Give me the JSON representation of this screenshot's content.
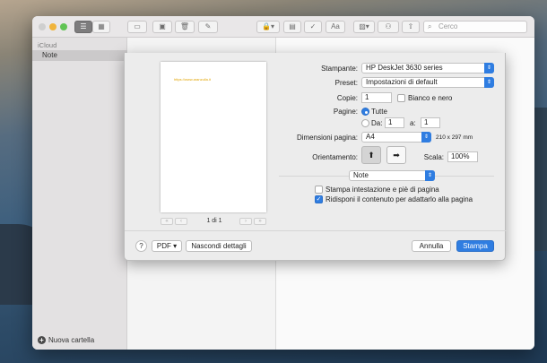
{
  "search": {
    "placeholder": "Cerco",
    "icon": "search-icon"
  },
  "sidebar": {
    "heading": "iCloud",
    "items": [
      {
        "label": "Note"
      }
    ],
    "footer_label": "Nuova cartella"
  },
  "preview": {
    "url_text": "https://www.aranzulla.it",
    "page_indicator": "1 di 1",
    "nav_first": "«",
    "nav_prev": "‹",
    "nav_next": "›",
    "nav_last": "»"
  },
  "print": {
    "printer_label": "Stampante:",
    "printer_value": "HP DeskJet 3630 series",
    "preset_label": "Preset:",
    "preset_value": "Impostazioni di default",
    "copies_label": "Copie:",
    "copies_value": "1",
    "bw_label": "Bianco e nero",
    "pages_label": "Pagine:",
    "pages_all": "Tutte",
    "pages_from_label": "Da:",
    "pages_from_value": "1",
    "pages_to_label": "a:",
    "pages_to_value": "1",
    "paper_label": "Dimensioni pagina:",
    "paper_value": "A4",
    "paper_dims": "210 x 297 mm",
    "orientation_label": "Orientamento:",
    "scale_label": "Scala:",
    "scale_value": "100%",
    "section_value": "Note",
    "header_footer_label": "Stampa intestazione e piè di pagina",
    "fit_label": "Ridisponi il contenuto per adattarlo alla pagina"
  },
  "buttons": {
    "help": "?",
    "pdf": "PDF",
    "details": "Nascondi dettagli",
    "cancel": "Annulla",
    "print": "Stampa"
  },
  "colors": {
    "accent": "#2f7de1",
    "url": "#e2a400"
  }
}
